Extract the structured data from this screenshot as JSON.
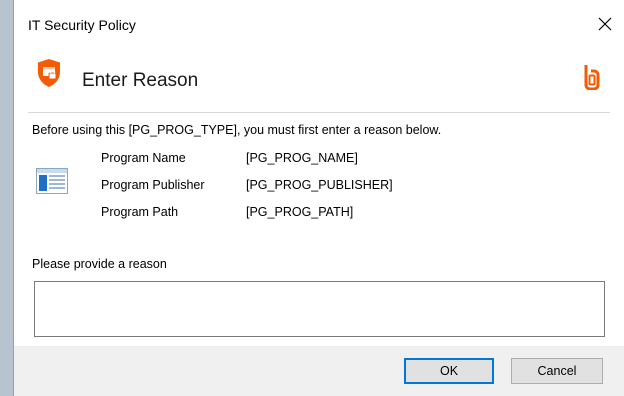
{
  "window": {
    "title": "IT Security Policy",
    "close_glyph": "✕"
  },
  "header": {
    "title": "Enter Reason",
    "icon": "shield-icon",
    "brand_icon": "beyondtrust-logo",
    "accent_color": "#f25c05"
  },
  "body": {
    "intro": "Before using this [PG_PROG_TYPE], you must first enter a reason below.",
    "app_icon": "application-window-icon",
    "info": [
      {
        "label": "Program Name",
        "value": "[PG_PROG_NAME]"
      },
      {
        "label": "Program Publisher",
        "value": "[PG_PROG_PUBLISHER]"
      },
      {
        "label": "Program Path",
        "value": "[PG_PROG_PATH]"
      }
    ],
    "reason_label": "Please provide a reason",
    "reason_value": ""
  },
  "footer": {
    "ok_label": "OK",
    "cancel_label": "Cancel"
  }
}
